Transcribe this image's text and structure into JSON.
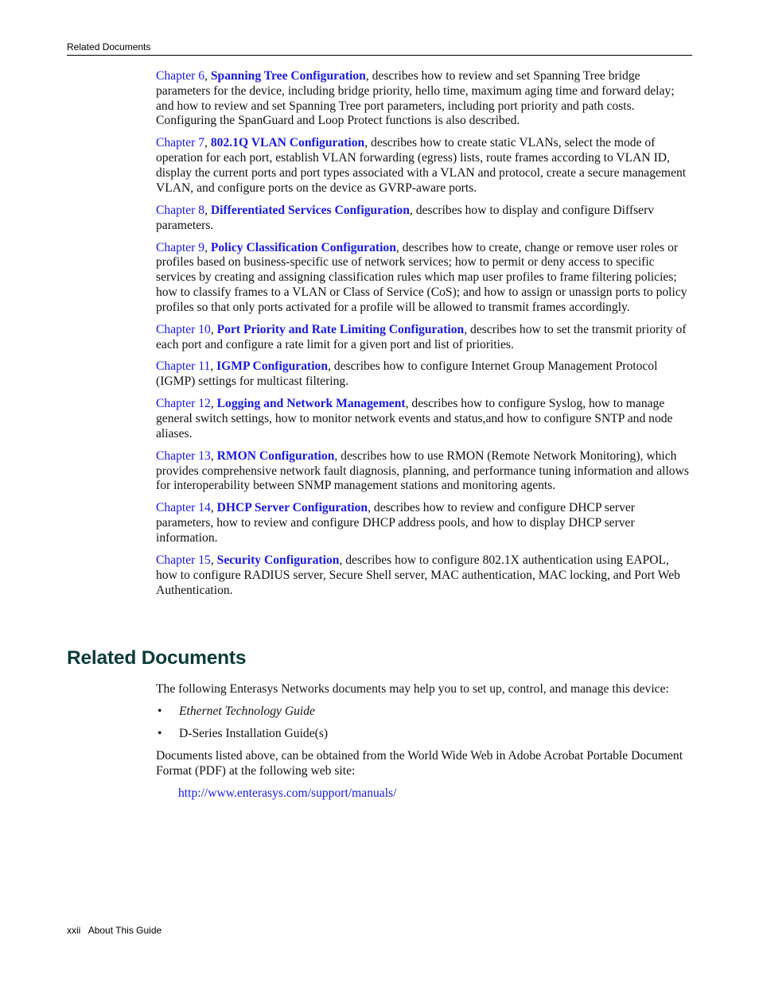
{
  "header": {
    "running_title": "Related Documents"
  },
  "chapters": [
    {
      "ref": "Chapter 6",
      "title": "Spanning Tree Configuration",
      "desc": ", describes how to review and set Spanning Tree bridge parameters for the device, including bridge priority, hello time, maximum aging time and forward delay; and how to review and set Spanning Tree port parameters, including port priority and path costs. Configuring the SpanGuard and Loop Protect functions is also described."
    },
    {
      "ref": "Chapter 7",
      "title": "802.1Q VLAN Configuration",
      "desc": ", describes how to create static VLANs, select the mode of operation for each port, establish VLAN forwarding (egress) lists, route frames according to VLAN ID, display the current ports and port types associated with a VLAN and protocol, create a secure management VLAN, and configure ports on the device as GVRP-aware ports."
    },
    {
      "ref": "Chapter 8",
      "title": "Differentiated Services Configuration",
      "desc": ", describes how to display and configure Diffserv parameters."
    },
    {
      "ref": "Chapter 9",
      "title": "Policy Classification Configuration",
      "desc": ", describes how to create, change or remove user roles or profiles based on business-specific use of network services; how to permit or deny access to specific services by creating and assigning classification rules which map user profiles to frame filtering policies; how to classify frames to a VLAN or Class of Service (CoS); and how to assign or unassign ports to policy profiles so that only ports activated for a profile will be allowed to transmit frames accordingly."
    },
    {
      "ref": "Chapter 10",
      "title": "Port Priority and Rate Limiting Configuration",
      "desc": ", describes how to set the transmit priority of each port and configure a rate limit for a given port and list of priorities."
    },
    {
      "ref": "Chapter 11",
      "title": "IGMP Configuration",
      "desc": ", describes how to configure Internet Group Management Protocol (IGMP) settings for multicast filtering."
    },
    {
      "ref": "Chapter 12",
      "title": "Logging and Network Management",
      "desc": ", describes how to configure Syslog, how to manage general switch settings, how to monitor network events and status,and how to configure SNTP and node aliases."
    },
    {
      "ref": "Chapter 13",
      "title": "RMON Configuration",
      "desc": ", describes how to use RMON (Remote Network Monitoring), which provides comprehensive network fault diagnosis, planning, and performance tuning information and allows for interoperability between SNMP management stations and monitoring agents."
    },
    {
      "ref": "Chapter 14",
      "title": "DHCP Server Configuration",
      "desc": ", describes how to review and configure DHCP server parameters, how to review and configure DHCP address pools, and how to display DHCP server information."
    },
    {
      "ref": "Chapter 15",
      "title": "Security Configuration",
      "desc": ", describes how to configure 802.1X authentication using EAPOL, how to configure RADIUS server, Secure Shell server, MAC authentication, MAC locking, and Port Web Authentication."
    }
  ],
  "related": {
    "heading": "Related Documents",
    "intro": "The following Enterasys Networks documents may help you to set up, control, and manage this device:",
    "bullet_glyph": "•",
    "items": [
      {
        "text": "Ethernet Technology Guide",
        "italic": true
      },
      {
        "text": "D-Series Installation Guide(s)",
        "italic": false
      }
    ],
    "availability": "Documents listed above, can be obtained from the World Wide Web in Adobe Acrobat Portable Document Format (PDF) at the following web site:",
    "url": "http://www.enterasys.com/support/manuals/"
  },
  "footer": {
    "page_number": "xxii",
    "section": "About This Guide"
  },
  "colors": {
    "link": "#1a1adb",
    "heading": "#0c3b3b",
    "text": "#111111"
  }
}
